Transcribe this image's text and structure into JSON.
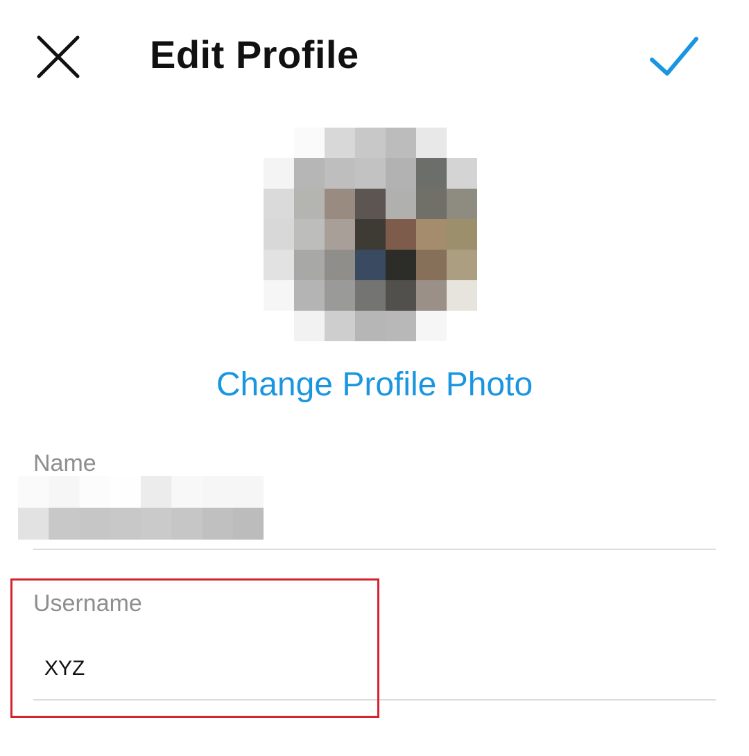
{
  "header": {
    "title": "Edit Profile",
    "close_icon": "close-icon",
    "confirm_icon": "checkmark-icon",
    "confirm_color": "#1a96e0"
  },
  "profile_photo": {
    "icon": "pixelated-avatar",
    "change_label": "Change Profile Photo",
    "link_color": "#1a96e0"
  },
  "fields": {
    "name": {
      "label": "Name",
      "value_obscured": true
    },
    "username": {
      "label": "Username",
      "value": "XYZ"
    }
  },
  "annotation": {
    "highlight_color": "#d6242f",
    "highlight_target": "username"
  }
}
